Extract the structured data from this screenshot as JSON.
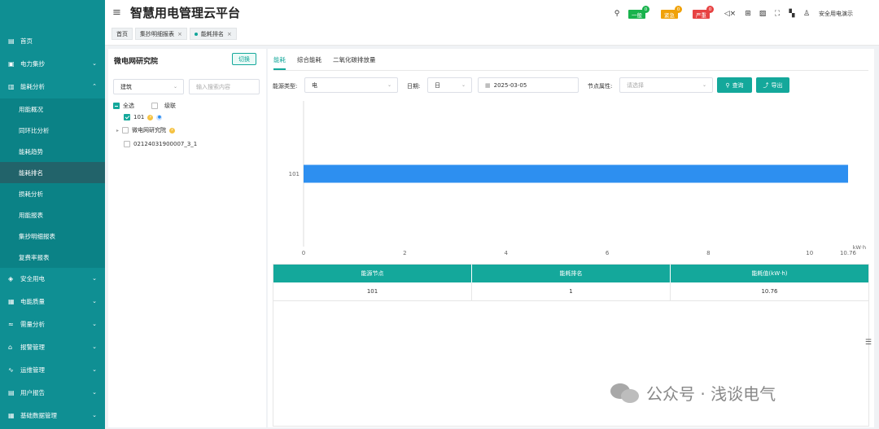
{
  "header": {
    "title": "智慧用电管理云平台",
    "alerts": [
      {
        "label": "一般",
        "count": "0",
        "color": "#19b34d",
        "count_color": "#19b34d"
      },
      {
        "label": "紧急",
        "count": "0",
        "color": "#f0a20a",
        "count_color": "#f0a20a"
      },
      {
        "label": "严重",
        "count": "0",
        "color": "#e74242",
        "count_color": "#e74242"
      }
    ],
    "user": "安全用电演示"
  },
  "tags": [
    {
      "label": "首页"
    },
    {
      "label": "集抄明细报表"
    },
    {
      "label": "能耗排名"
    }
  ],
  "sidebar": {
    "items": [
      {
        "label": "首页",
        "icon": "home-icon"
      },
      {
        "label": "电力集抄",
        "icon": "meter-icon"
      },
      {
        "label": "能耗分析",
        "icon": "bar-chart-icon"
      },
      {
        "label": "安全用电",
        "icon": "fire-icon"
      },
      {
        "label": "电能质量",
        "icon": "monitor-icon"
      },
      {
        "label": "需量分析",
        "icon": "wave-icon"
      },
      {
        "label": "报警管理",
        "icon": "alarm-icon"
      },
      {
        "label": "运维管理",
        "icon": "pulse-icon"
      },
      {
        "label": "用户报告",
        "icon": "report-icon"
      },
      {
        "label": "基础数据管理",
        "icon": "database-icon"
      }
    ],
    "sub_items": [
      {
        "label": "用能概况"
      },
      {
        "label": "同环比分析"
      },
      {
        "label": "能耗趋势"
      },
      {
        "label": "能耗排名"
      },
      {
        "label": "损耗分析"
      },
      {
        "label": "用能报表"
      },
      {
        "label": "集抄明细报表"
      },
      {
        "label": "复费率报表"
      }
    ]
  },
  "left_panel": {
    "title": "微电网研究院",
    "switch_label": "切换",
    "category_select": "建筑",
    "search_placeholder": "输入搜索内容",
    "select_all": "全选",
    "cascade": "级联",
    "tree": [
      {
        "label": "101"
      },
      {
        "label": "微电网研究院"
      },
      {
        "label": "02124031900007_3_1"
      }
    ]
  },
  "right_panel": {
    "tabs": [
      "能耗",
      "综合能耗",
      "二氧化碳排放量"
    ],
    "filters": {
      "energy_type_label": "能源类型:",
      "energy_type_value": "电",
      "date_label": "日期:",
      "date_unit": "日",
      "date_value": "2025-03-05",
      "node_attr_label": "节点属性:",
      "node_attr_placeholder": "请选择",
      "query_label": "查询",
      "export_label": "导出"
    }
  },
  "chart_data": {
    "type": "bar",
    "orientation": "horizontal",
    "categories": [
      "101"
    ],
    "values": [
      10.76
    ],
    "xlim": [
      0,
      10.76
    ],
    "x_ticks": [
      "0",
      "2",
      "4",
      "6",
      "8",
      "10",
      "10.76"
    ],
    "xlabel": "kW·h",
    "color": "#2d8ff0"
  },
  "table": {
    "headers": [
      "能源节点",
      "能耗排名",
      "能耗值(kW·h)"
    ],
    "rows": [
      [
        "101",
        "1",
        "10.76"
      ]
    ]
  },
  "watermark": "公众号 · 浅谈电气",
  "colors": {
    "primary": "#14a89b",
    "sidebar": "#0f8f93",
    "bar": "#2d8ff0"
  }
}
